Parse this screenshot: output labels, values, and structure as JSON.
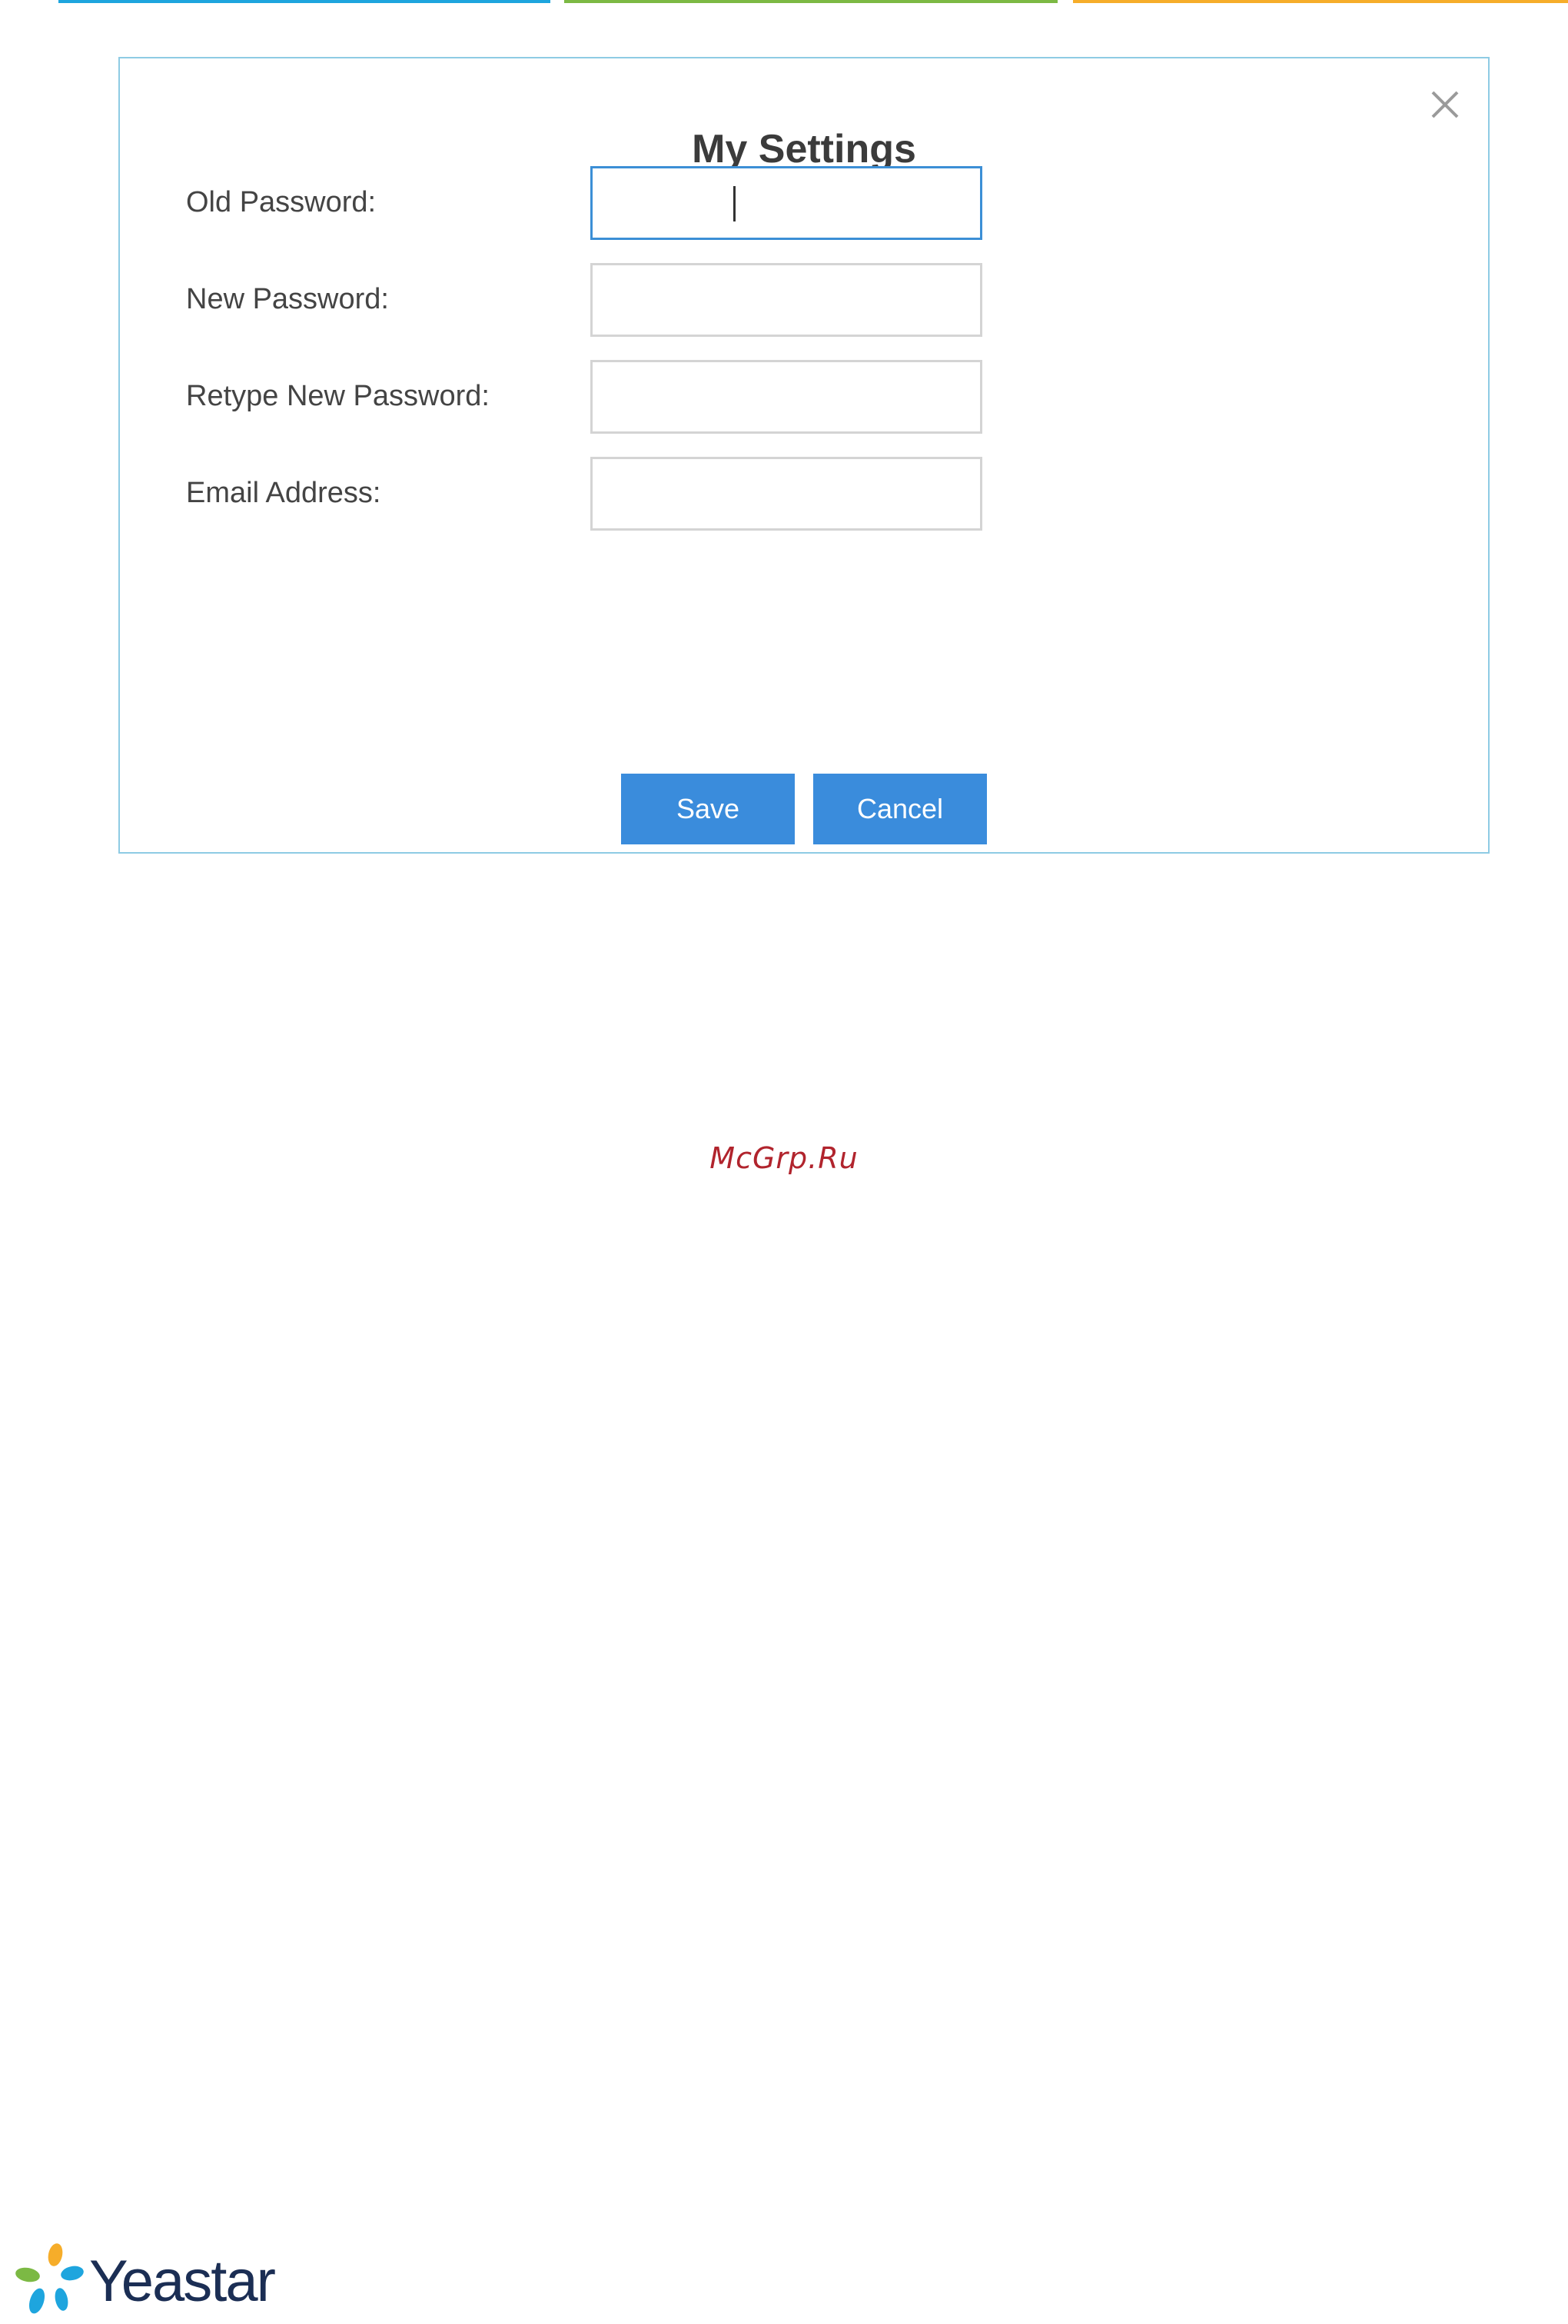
{
  "top_bars": [
    {
      "color": "#1ea5de"
    },
    {
      "color": "#7cb944"
    },
    {
      "color": "#f6ad2a"
    }
  ],
  "dialog": {
    "title": "My Settings",
    "close_icon": "close-icon",
    "fields": [
      {
        "label": "Old Password:",
        "value": "",
        "focused": true
      },
      {
        "label": "New Password:",
        "value": "",
        "focused": false
      },
      {
        "label": "Retype New Password:",
        "value": "",
        "focused": false
      },
      {
        "label": "Email Address:",
        "value": "",
        "focused": false
      }
    ],
    "save_label": "Save",
    "cancel_label": "Cancel"
  },
  "watermark": "McGrp.Ru",
  "logo": {
    "text": "Yeastar",
    "icon": "yeastar-logo-icon"
  },
  "colors": {
    "accent": "#3a8cdc",
    "dialog_border": "#8ecbe4",
    "focus_border": "#3c8fd6",
    "watermark": "#b1242d",
    "logo_text": "#1b2e54"
  }
}
